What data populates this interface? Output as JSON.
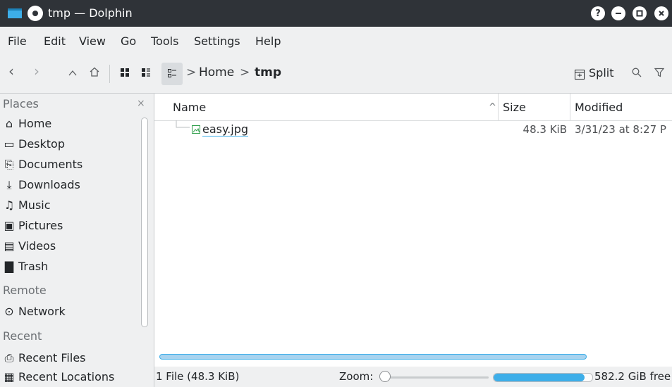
{
  "window": {
    "title": "tmp — Dolphin",
    "controls": {
      "help": "?",
      "minimize": "–",
      "maximize": "□",
      "close": "×"
    }
  },
  "menubar": {
    "items": [
      "File",
      "Edit",
      "View",
      "Go",
      "Tools",
      "Settings",
      "Help"
    ]
  },
  "toolbar": {
    "breadcrumb": {
      "home": "Home",
      "separator": ">",
      "current": "tmp"
    },
    "split_label": "Split",
    "icons": [
      "back-icon",
      "forward-icon",
      "up-icon",
      "home-icon",
      "icons-view-icon",
      "compact-view-icon",
      "details-view-icon",
      "search-icon",
      "filter-icon"
    ]
  },
  "sidebar": {
    "sections": [
      {
        "header": "Places",
        "items": [
          {
            "label": "Home",
            "icon": "home-icon"
          },
          {
            "label": "Desktop",
            "icon": "desktop-icon"
          },
          {
            "label": "Documents",
            "icon": "documents-icon"
          },
          {
            "label": "Downloads",
            "icon": "downloads-icon"
          },
          {
            "label": "Music",
            "icon": "music-icon"
          },
          {
            "label": "Pictures",
            "icon": "pictures-icon"
          },
          {
            "label": "Videos",
            "icon": "videos-icon"
          },
          {
            "label": "Trash",
            "icon": "trash-icon"
          }
        ]
      },
      {
        "header": "Remote",
        "items": [
          {
            "label": "Network",
            "icon": "network-icon"
          }
        ]
      },
      {
        "header": "Recent",
        "items": [
          {
            "label": "Recent Files",
            "icon": "recent-files-icon"
          },
          {
            "label": "Recent Locations",
            "icon": "recent-locations-icon"
          }
        ]
      }
    ]
  },
  "file_view": {
    "columns": [
      "Name",
      "Size",
      "Modified"
    ],
    "sort_indicator": "^",
    "rows": [
      {
        "name": "easy.jpg",
        "size": "48.3 KiB",
        "modified": "3/31/23 at 8:27 P",
        "icon": "image-file-icon"
      }
    ]
  },
  "statusbar": {
    "summary": "1 File (48.3 KiB)",
    "zoom_label": "Zoom:",
    "free_space": "582.2 GiB free",
    "used_fraction": 0.92
  },
  "colors": {
    "titlebar": "#2f3338",
    "chrome": "#eff0f1",
    "accent": "#3daee9",
    "image_icon": "#2e9e4a"
  }
}
